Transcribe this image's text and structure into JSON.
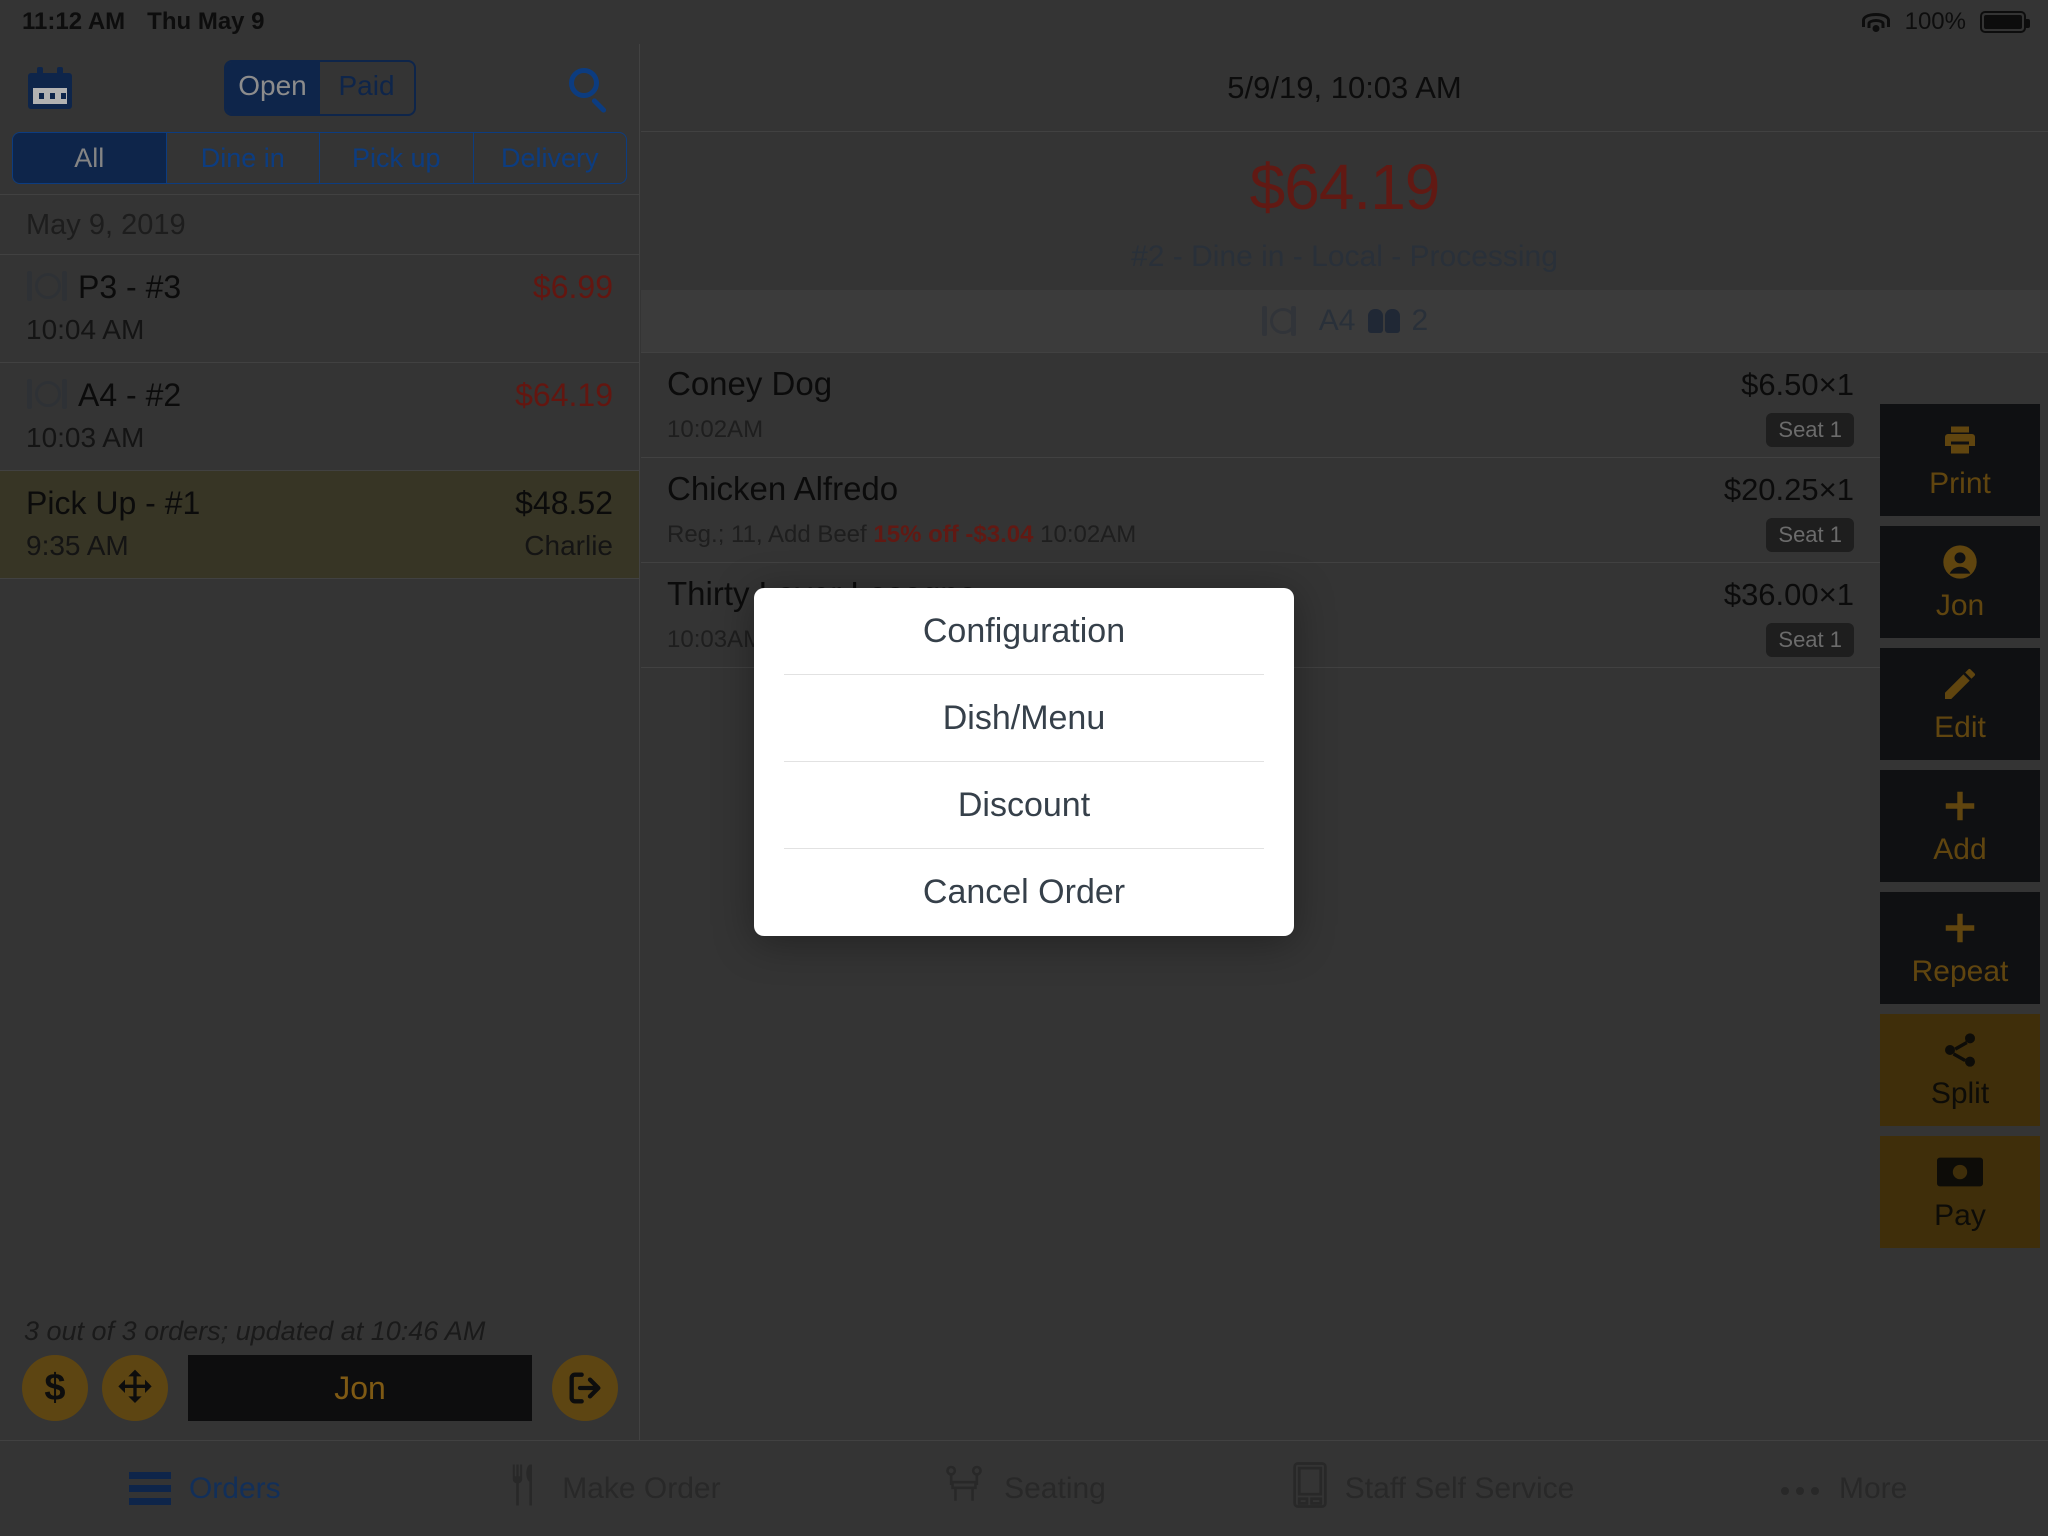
{
  "status_bar": {
    "time": "11:12 AM",
    "date": "Thu May 9",
    "battery_percent": "100%",
    "wifi_icon": "wifi-icon",
    "battery_icon": "battery-icon"
  },
  "left_pane": {
    "calendar_icon": "calendar-icon",
    "search_icon": "search-icon",
    "open_paid_segments": [
      {
        "label": "Open",
        "active": true
      },
      {
        "label": "Paid",
        "active": false
      }
    ],
    "type_segments": [
      {
        "label": "All",
        "active": true
      },
      {
        "label": "Dine in",
        "active": false
      },
      {
        "label": "Pick up",
        "active": false
      },
      {
        "label": "Delivery",
        "active": false
      }
    ],
    "date_header": "May 9, 2019",
    "orders": [
      {
        "title": "P3 - #3",
        "time": "10:04 AM",
        "price": "$6.99",
        "sub": "",
        "selected": false,
        "has_plate_icon": true
      },
      {
        "title": "A4 - #2",
        "time": "10:03 AM",
        "price": "$64.19",
        "sub": "",
        "selected": false,
        "has_plate_icon": true
      },
      {
        "title": "Pick Up - #1",
        "time": "9:35 AM",
        "price": "$48.52",
        "sub": "Charlie",
        "selected": true,
        "has_plate_icon": false
      }
    ],
    "footer": {
      "status_text": "3 out of 3 orders; updated at 10:46 AM",
      "cash_icon": "$",
      "move_icon": "move-icon",
      "staff_button": "Jon",
      "logout_icon": "logout-icon"
    }
  },
  "right_pane": {
    "datetime": "5/9/19, 10:03 AM",
    "total": "$64.19",
    "meta": "#2 - Dine in - Local - Processing",
    "table_label": "A4",
    "guest_count": "2",
    "plate_icon": "plate-icon",
    "people_icon": "people-icon",
    "items": [
      {
        "name": "Coney Dog",
        "price": "$6.50×1",
        "note_plain": "10:02AM",
        "note_pre": "",
        "note_discount": "",
        "note_post": "",
        "seat": "Seat 1"
      },
      {
        "name": "Chicken Alfredo",
        "price": "$20.25×1",
        "note_plain": "",
        "note_pre": "Reg.; 11, Add Beef ",
        "note_discount": "15% off -$3.04",
        "note_post": " 10:02AM",
        "seat": "Seat 1"
      },
      {
        "name": "Thirty Layer Lasagna",
        "price": "$36.00×1",
        "note_plain": "10:03AM",
        "note_pre": "",
        "note_discount": "",
        "note_post": "",
        "seat": "Seat 1"
      }
    ]
  },
  "action_rail": [
    {
      "label": "Print",
      "icon": "printer-icon",
      "style": "dark"
    },
    {
      "label": "Jon",
      "icon": "person-icon",
      "style": "dark"
    },
    {
      "label": "Edit",
      "icon": "pencil-icon",
      "style": "dark"
    },
    {
      "label": "Add",
      "icon": "plus-icon",
      "style": "dark"
    },
    {
      "label": "Repeat",
      "icon": "plus-icon",
      "style": "dark"
    },
    {
      "label": "Split",
      "icon": "share-icon",
      "style": "gold"
    },
    {
      "label": "Pay",
      "icon": "money-icon",
      "style": "gold"
    }
  ],
  "tabbar": [
    {
      "label": "Orders",
      "icon": "hamburger-icon",
      "active": true
    },
    {
      "label": "Make Order",
      "icon": "cutlery-icon",
      "active": false
    },
    {
      "label": "Seating",
      "icon": "table-icon",
      "active": false
    },
    {
      "label": "Staff Self Service",
      "icon": "tablet-icon",
      "active": false
    },
    {
      "label": "More",
      "icon": "ellipsis-icon",
      "active": false
    }
  ],
  "modal": {
    "items": [
      {
        "label": "Configuration"
      },
      {
        "label": "Dish/Menu"
      },
      {
        "label": "Discount"
      },
      {
        "label": "Cancel Order"
      }
    ]
  },
  "colors": {
    "accent_blue": "#15356b",
    "link_blue": "#1257b8",
    "price_red": "#8c241c",
    "gold": "#86631b",
    "selected_row": "#504c36"
  }
}
